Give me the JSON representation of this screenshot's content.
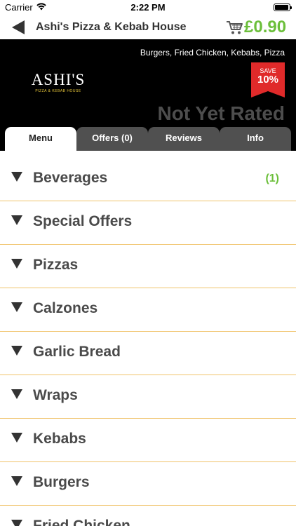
{
  "status_bar": {
    "carrier": "Carrier",
    "time": "2:22 PM"
  },
  "nav": {
    "title": "Ashi's Pizza & Kebab House",
    "cart_total": "£0.90"
  },
  "header": {
    "cuisines": "Burgers, Fried Chicken, Kebabs, Pizza",
    "logo_main": "ASHI'S",
    "logo_sub": "PIZZA & KEBAB HOUSE",
    "save_label": "SAVE",
    "save_percent": "10%",
    "rating": "Not Yet Rated"
  },
  "tabs": [
    {
      "label": "Menu",
      "active": true
    },
    {
      "label": "Offers (0)",
      "active": false
    },
    {
      "label": "Reviews",
      "active": false
    },
    {
      "label": "Info",
      "active": false
    }
  ],
  "menu": [
    {
      "label": "Beverages",
      "count": "(1)"
    },
    {
      "label": "Special Offers",
      "count": ""
    },
    {
      "label": "Pizzas",
      "count": ""
    },
    {
      "label": "Calzones",
      "count": ""
    },
    {
      "label": "Garlic Bread",
      "count": ""
    },
    {
      "label": "Wraps",
      "count": ""
    },
    {
      "label": "Kebabs",
      "count": ""
    },
    {
      "label": "Burgers",
      "count": ""
    },
    {
      "label": "Fried Chicken",
      "count": ""
    }
  ],
  "colors": {
    "accent_green": "#6cbf3b",
    "divider": "#f0c36a",
    "badge_red": "#e02a2a",
    "tab_inactive": "#505050"
  },
  "icons": {
    "back": "back-arrow-icon",
    "cart": "shopping-cart-icon",
    "expand": "triangle-down-icon"
  }
}
